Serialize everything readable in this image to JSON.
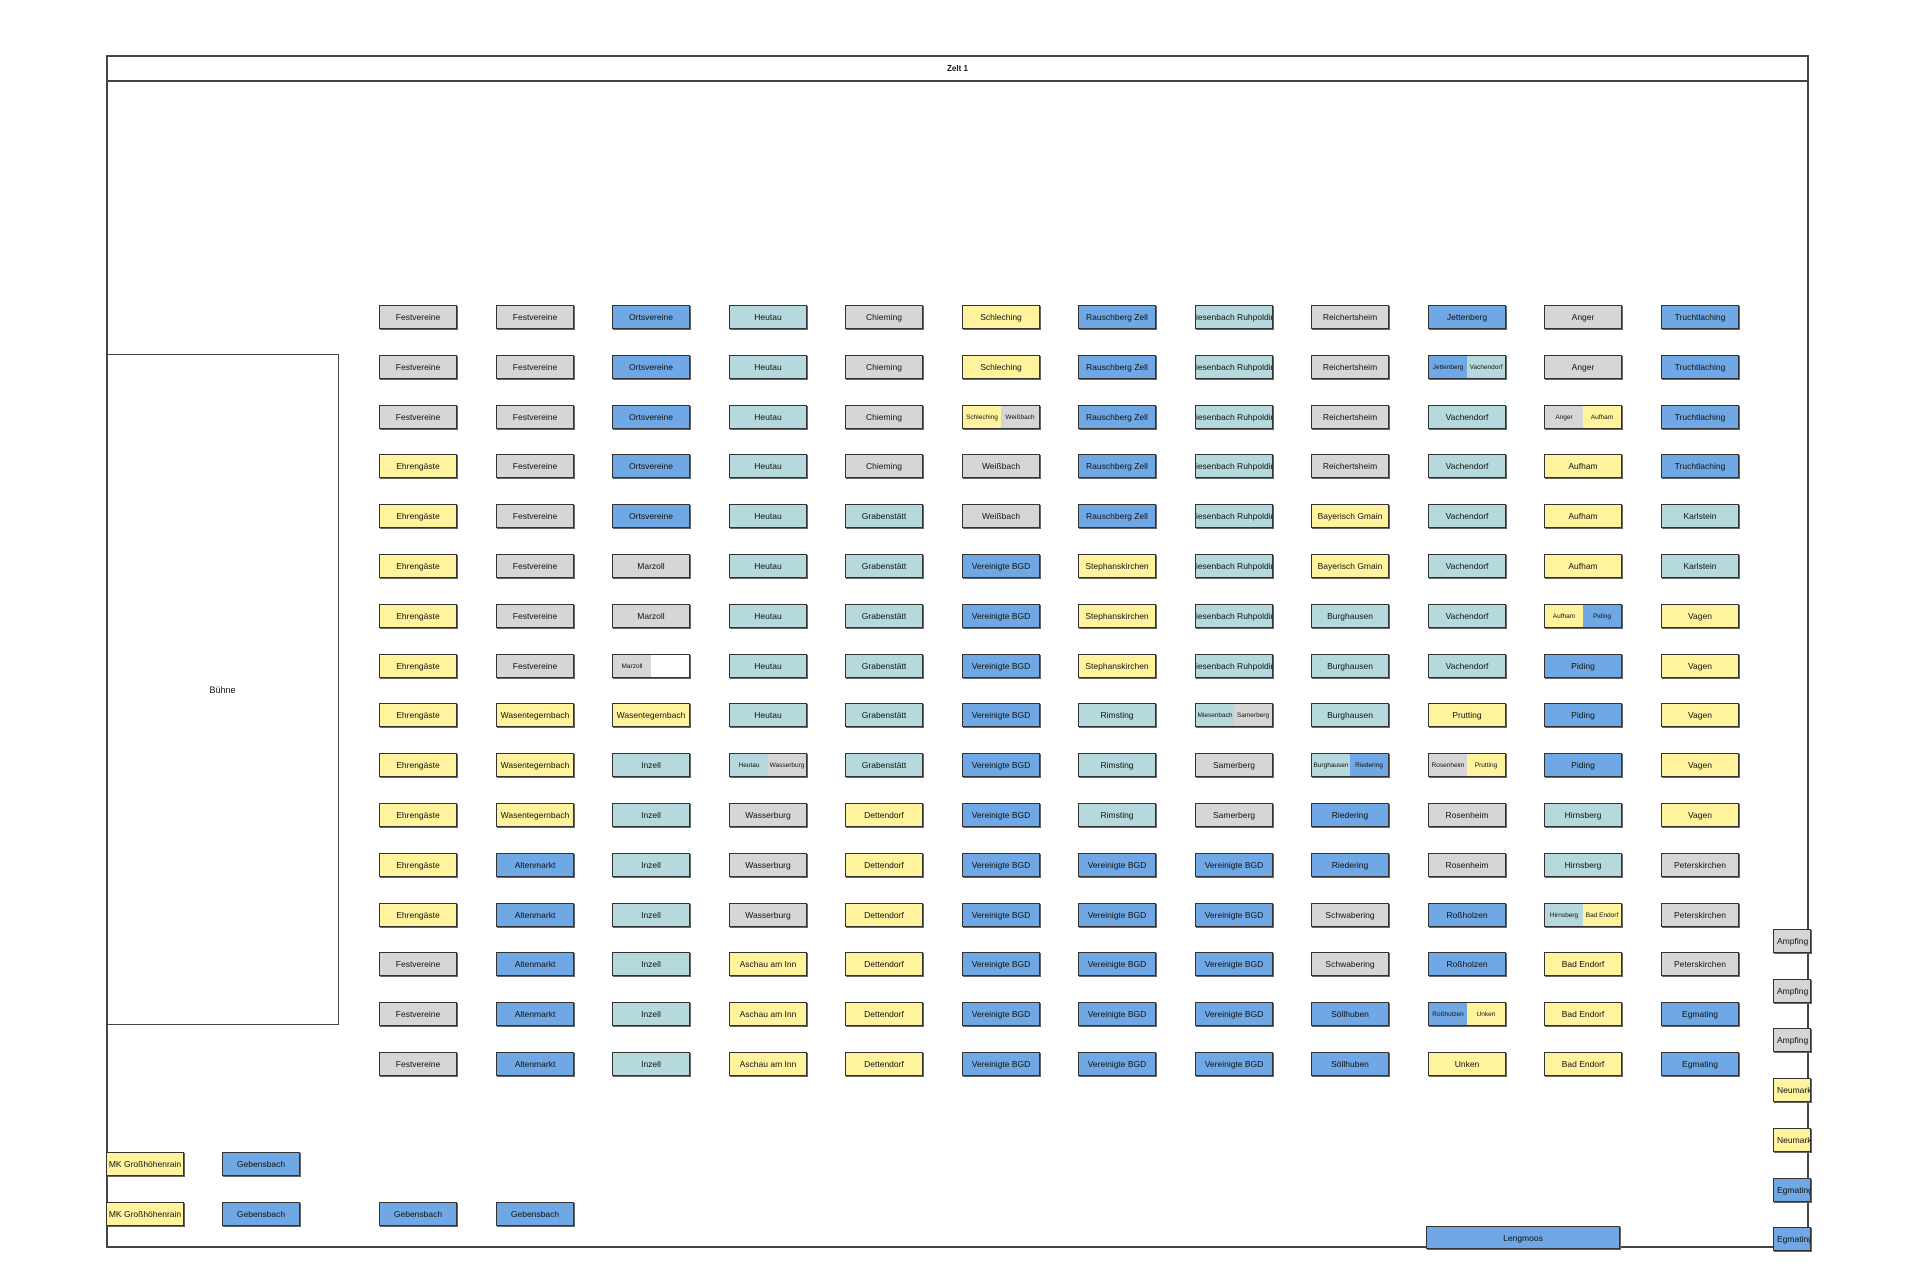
{
  "title": "Zelt 1",
  "stage_label": "Bühne",
  "colors": {
    "gray": "#d6d6d6",
    "yellow": "#fff39e",
    "blue": "#6fa8e4",
    "teal": "#b5d9dc",
    "white": "#ffffff"
  },
  "columns": [
    [
      [
        "Festvereine"
      ],
      [
        "Festvereine"
      ],
      [
        "Festvereine"
      ],
      [
        "Ehrengäste"
      ],
      [
        "Ehrengäste"
      ],
      [
        "Ehrengäste"
      ],
      [
        "Ehrengäste"
      ],
      [
        "Ehrengäste"
      ],
      [
        "Ehrengäste"
      ],
      [
        "Ehrengäste"
      ],
      [
        "Ehrengäste"
      ],
      [
        "Ehrengäste"
      ],
      [
        "Ehrengäste"
      ],
      [
        "Festvereine"
      ],
      [
        "Festvereine"
      ],
      [
        "Festvereine"
      ]
    ],
    [
      [
        "Festvereine"
      ],
      [
        "Festvereine"
      ],
      [
        "Festvereine"
      ],
      [
        "Festvereine"
      ],
      [
        "Festvereine"
      ],
      [
        "Festvereine"
      ],
      [
        "Festvereine"
      ],
      [
        "Festvereine"
      ],
      [
        "Wasentegernbach"
      ],
      [
        "Wasentegernbach"
      ],
      [
        "Wasentegernbach"
      ],
      [
        "Altenmarkt"
      ],
      [
        "Altenmarkt"
      ],
      [
        "Altenmarkt"
      ],
      [
        "Altenmarkt"
      ],
      [
        "Altenmarkt"
      ]
    ],
    [
      [
        "Ortsvereine"
      ],
      [
        "Ortsvereine"
      ],
      [
        "Ortsvereine"
      ],
      [
        "Ortsvereine"
      ],
      [
        "Ortsvereine"
      ],
      [
        "Marzoll"
      ],
      [
        "Marzoll"
      ],
      [
        "Marzoll",
        ""
      ],
      [
        "Wasentegernbach"
      ],
      [
        "Inzell"
      ],
      [
        "Inzell"
      ],
      [
        "Inzell"
      ],
      [
        "Inzell"
      ],
      [
        "Inzell"
      ],
      [
        "Inzell"
      ],
      [
        "Inzell"
      ]
    ],
    [
      [
        "Heutau"
      ],
      [
        "Heutau"
      ],
      [
        "Heutau"
      ],
      [
        "Heutau"
      ],
      [
        "Heutau"
      ],
      [
        "Heutau"
      ],
      [
        "Heutau"
      ],
      [
        "Heutau"
      ],
      [
        "Heutau"
      ],
      [
        "Heutau",
        "Wasserburg"
      ],
      [
        "Wasserburg"
      ],
      [
        "Wasserburg"
      ],
      [
        "Wasserburg"
      ],
      [
        "Aschau am Inn"
      ],
      [
        "Aschau am Inn"
      ],
      [
        "Aschau am Inn"
      ]
    ],
    [
      [
        "Chieming"
      ],
      [
        "Chieming"
      ],
      [
        "Chieming"
      ],
      [
        "Chieming"
      ],
      [
        "Grabenstätt"
      ],
      [
        "Grabenstätt"
      ],
      [
        "Grabenstätt"
      ],
      [
        "Grabenstätt"
      ],
      [
        "Grabenstätt"
      ],
      [
        "Grabenstätt"
      ],
      [
        "Dettendorf"
      ],
      [
        "Dettendorf"
      ],
      [
        "Dettendorf"
      ],
      [
        "Dettendorf"
      ],
      [
        "Dettendorf"
      ],
      [
        "Dettendorf"
      ]
    ],
    [
      [
        "Schleching"
      ],
      [
        "Schleching"
      ],
      [
        "Schleching",
        "Weißbach"
      ],
      [
        "Weißbach"
      ],
      [
        "Weißbach"
      ],
      [
        "Vereinigte BGD"
      ],
      [
        "Vereinigte BGD"
      ],
      [
        "Vereinigte BGD"
      ],
      [
        "Vereinigte BGD"
      ],
      [
        "Vereinigte BGD"
      ],
      [
        "Vereinigte BGD"
      ],
      [
        "Vereinigte BGD"
      ],
      [
        "Vereinigte BGD"
      ],
      [
        "Vereinigte BGD"
      ],
      [
        "Vereinigte BGD"
      ],
      [
        "Vereinigte BGD"
      ]
    ],
    [
      [
        "Rauschberg Zell"
      ],
      [
        "Rauschberg Zell"
      ],
      [
        "Rauschberg Zell"
      ],
      [
        "Rauschberg Zell"
      ],
      [
        "Rauschberg Zell"
      ],
      [
        "Stephanskirchen"
      ],
      [
        "Stephanskirchen"
      ],
      [
        "Stephanskirchen"
      ],
      [
        "Rimsting"
      ],
      [
        "Rimsting"
      ],
      [
        "Rimsting"
      ],
      [
        "Vereinigte BGD"
      ],
      [
        "Vereinigte BGD"
      ],
      [
        "Vereinigte BGD"
      ],
      [
        "Vereinigte BGD"
      ],
      [
        "Vereinigte BGD"
      ]
    ],
    [
      [
        "Wiesenbach Ruhpolding"
      ],
      [
        "Wiesenbach Ruhpolding"
      ],
      [
        "Wiesenbach Ruhpolding"
      ],
      [
        "Wiesenbach Ruhpolding"
      ],
      [
        "Wiesenbach Ruhpolding"
      ],
      [
        "Wiesenbach Ruhpolding"
      ],
      [
        "Wiesenbach Ruhpolding"
      ],
      [
        "Wiesenbach Ruhpolding"
      ],
      [
        "Miesenbach",
        "Samerberg"
      ],
      [
        "Samerberg"
      ],
      [
        "Samerberg"
      ],
      [
        "Vereinigte BGD"
      ],
      [
        "Vereinigte BGD"
      ],
      [
        "Vereinigte BGD"
      ],
      [
        "Vereinigte BGD"
      ],
      [
        "Vereinigte BGD"
      ]
    ],
    [
      [
        "Reichertsheim"
      ],
      [
        "Reichertsheim"
      ],
      [
        "Reichertsheim"
      ],
      [
        "Reichertsheim"
      ],
      [
        "Bayerisch Gmain"
      ],
      [
        "Bayerisch Gmain"
      ],
      [
        "Burghausen"
      ],
      [
        "Burghausen"
      ],
      [
        "Burghausen"
      ],
      [
        "Burghausen",
        "Riedering"
      ],
      [
        "Riedering"
      ],
      [
        "Riedering"
      ],
      [
        "Schwabering"
      ],
      [
        "Schwabering"
      ],
      [
        "Söllhuben"
      ],
      [
        "Söllhuben"
      ]
    ],
    [
      [
        "Jettenberg"
      ],
      [
        "Jettenberg",
        "Vachendorf"
      ],
      [
        "Vachendorf"
      ],
      [
        "Vachendorf"
      ],
      [
        "Vachendorf"
      ],
      [
        "Vachendorf"
      ],
      [
        "Vachendorf"
      ],
      [
        "Vachendorf"
      ],
      [
        "Prutting"
      ],
      [
        "Rosenheim",
        "Prutting"
      ],
      [
        "Rosenheim"
      ],
      [
        "Rosenheim"
      ],
      [
        "Roßholzen"
      ],
      [
        "Roßholzen"
      ],
      [
        "Roßholzen",
        "Unken"
      ],
      [
        "Unken"
      ]
    ],
    [
      [
        "Anger"
      ],
      [
        "Anger"
      ],
      [
        "Anger",
        "Aufham"
      ],
      [
        "Aufham"
      ],
      [
        "Aufham"
      ],
      [
        "Aufham"
      ],
      [
        "Aufham",
        "Piding"
      ],
      [
        "Piding"
      ],
      [
        "Piding"
      ],
      [
        "Piding"
      ],
      [
        "Hirnsberg"
      ],
      [
        "Hirnsberg"
      ],
      [
        "Hirnsberg",
        "Bad Endorf"
      ],
      [
        "Bad Endorf"
      ],
      [
        "Bad Endorf"
      ],
      [
        "Bad Endorf"
      ]
    ],
    [
      [
        "Truchtlaching"
      ],
      [
        "Truchtlaching"
      ],
      [
        "Truchtlaching"
      ],
      [
        "Truchtlaching"
      ],
      [
        "Karlstein"
      ],
      [
        "Karlstein"
      ],
      [
        "Vagen"
      ],
      [
        "Vagen"
      ],
      [
        "Vagen"
      ],
      [
        "Vagen"
      ],
      [
        "Vagen"
      ],
      [
        "Peterskirchen"
      ],
      [
        "Peterskirchen"
      ],
      [
        "Peterskirchen"
      ],
      [
        "Egmating"
      ],
      [
        "Egmating"
      ]
    ]
  ],
  "bottom_tables": {
    "left_col1": [
      "MK Großhöhenrain",
      "MK Großhöhenrain"
    ],
    "left_col2": [
      "Gebensbach",
      "Gebensbach"
    ],
    "row_extra": [
      "Gebensbach",
      "Gebensbach"
    ],
    "lengmoos": "Lengmoos"
  },
  "right_edge": [
    "Ampfing",
    "Ampfing",
    "Ampfing",
    "Neumarkt",
    "Neumarkt",
    "Egmating",
    "Egmating"
  ]
}
